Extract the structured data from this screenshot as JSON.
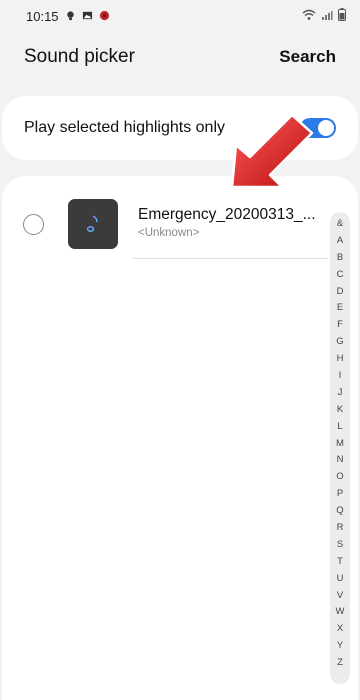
{
  "status_bar": {
    "time": "10:15",
    "icons_left": [
      "bulb-icon",
      "image-icon",
      "app-icon"
    ],
    "icons_right": [
      "wifi-icon",
      "signal-icon",
      "battery-icon"
    ]
  },
  "header": {
    "title": "Sound picker",
    "search_label": "Search"
  },
  "toggle": {
    "label": "Play selected highlights only",
    "on": true,
    "color": "#2c7be5"
  },
  "list": {
    "items": [
      {
        "title": "Emergency_20200313_...",
        "subtitle": "<Unknown>",
        "selected": false,
        "icon": "music-note-icon"
      }
    ]
  },
  "index": [
    "&",
    "A",
    "B",
    "C",
    "D",
    "E",
    "F",
    "G",
    "H",
    "I",
    "J",
    "K",
    "L",
    "M",
    "N",
    "O",
    "P",
    "Q",
    "R",
    "S",
    "T",
    "U",
    "V",
    "W",
    "X",
    "Y",
    "Z"
  ],
  "annotation": {
    "arrow_color": "#d81e1e"
  }
}
